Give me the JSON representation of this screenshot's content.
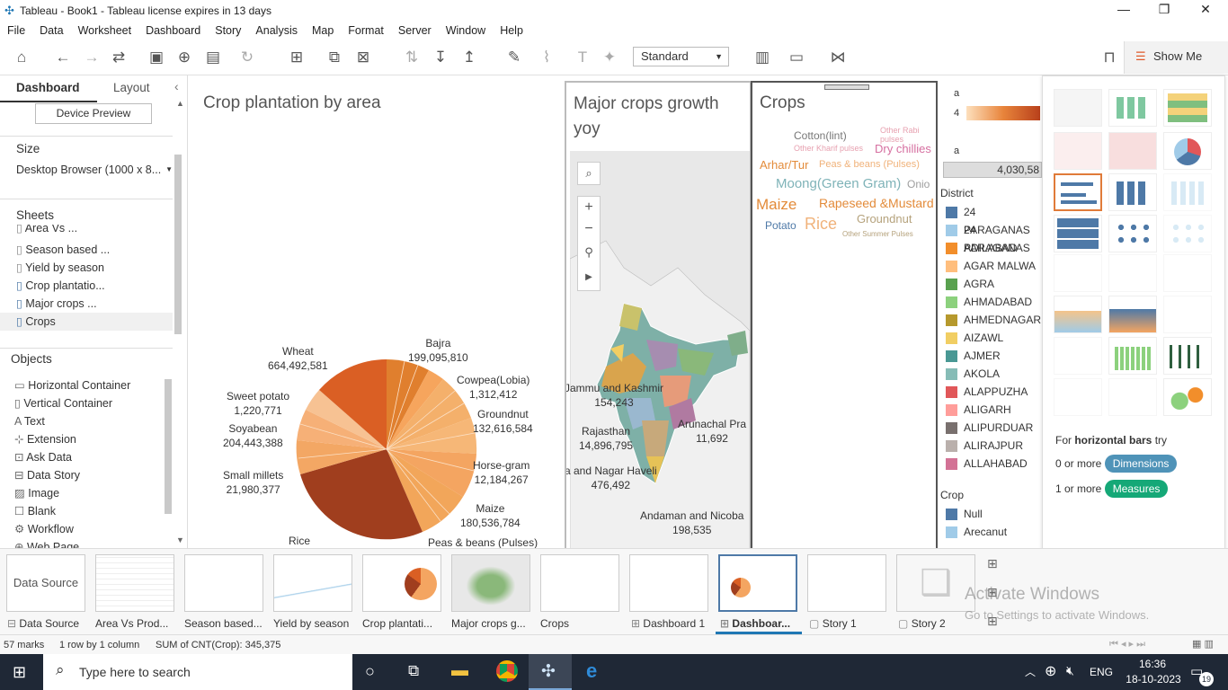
{
  "window": {
    "title": "Tableau - Book1 - Tableau license expires in 13 days"
  },
  "menu": [
    "File",
    "Data",
    "Worksheet",
    "Dashboard",
    "Story",
    "Analysis",
    "Map",
    "Format",
    "Server",
    "Window",
    "Help"
  ],
  "toolbar": {
    "fit_select": "Standard",
    "show_me": "Show Me"
  },
  "left": {
    "tab_dashboard": "Dashboard",
    "tab_layout": "Layout",
    "device_preview": "Device Preview",
    "size_header": "Size",
    "size_value": "Desktop Browser (1000 x 8...",
    "sheets_header": "Sheets",
    "sheets": [
      "Area Vs ...",
      "Season based ...",
      "Yield by season",
      "Crop plantatio...",
      "Major crops ...",
      "Crops"
    ],
    "objects_header": "Objects",
    "objects": [
      "Horizontal Container",
      "Vertical Container",
      "Text",
      "Extension",
      "Ask Data",
      "Data Story",
      "Image",
      "Blank",
      "Workflow",
      "Web Page"
    ]
  },
  "dashboard": {
    "pie_title": "Crop plantation by area",
    "pie_labels": [
      {
        "name": "Wheat",
        "value": "664,492,581"
      },
      {
        "name": "Bajra",
        "value": "199,095,810"
      },
      {
        "name": "Cowpea(Lobia)",
        "value": "1,312,412"
      },
      {
        "name": "Groundnut",
        "value": "132,616,584"
      },
      {
        "name": "Horse-gram",
        "value": "12,184,267"
      },
      {
        "name": "Maize",
        "value": "180,536,784"
      },
      {
        "name": "Peas & beans (Pulses)",
        "value": ""
      },
      {
        "name": "Rice",
        "value": ""
      },
      {
        "name": "Small millets",
        "value": "21,980,377"
      },
      {
        "name": "Soyabean",
        "value": "204,443,388"
      },
      {
        "name": "Sweet potato",
        "value": "1,220,771"
      }
    ],
    "map_title": "Major crops growth yoy",
    "map_labels": [
      {
        "name": "Jammu and Kashmir",
        "value": "154,243"
      },
      {
        "name": "Rajasthan",
        "value": "14,896,795"
      },
      {
        "name": "Arunachal Pra",
        "value": "11,692"
      },
      {
        "name": "a and Nagar Haveli",
        "value": "476,492"
      },
      {
        "name": "Andaman and Nicoba",
        "value": "198,535"
      }
    ],
    "crops_title": "Crops",
    "cloud": [
      {
        "t": "Other Rabi pulses",
        "c": "#e7a1b0",
        "s": 9
      },
      {
        "t": "Cotton(lint)",
        "c": "#777",
        "s": 12
      },
      {
        "t": "Other Kharif pulses",
        "c": "#e7a1b0",
        "s": 9
      },
      {
        "t": "Dry chillies",
        "c": "#d66fa0",
        "s": 13
      },
      {
        "t": "Arhar/Tur",
        "c": "#e38b3a",
        "s": 13
      },
      {
        "t": "Peas & beans (Pulses)",
        "c": "#f0b27a",
        "s": 11
      },
      {
        "t": "Moong(Green Gram)",
        "c": "#7fb3b8",
        "s": 15
      },
      {
        "t": "Onio",
        "c": "#9e9e9e",
        "s": 12
      },
      {
        "t": "Maize",
        "c": "#e38b3a",
        "s": 17
      },
      {
        "t": "Rapeseed &Mustard",
        "c": "#e38b3a",
        "s": 14
      },
      {
        "t": "Groundnut",
        "c": "#b5a27c",
        "s": 13
      },
      {
        "t": "Potato",
        "c": "#4e79a7",
        "s": 12
      },
      {
        "t": "Rice",
        "c": "#f0b27a",
        "s": 18
      },
      {
        "t": "Other Summer Pulses",
        "c": "#b5a27c",
        "s": 8
      }
    ],
    "legend": {
      "top_value": "4,030,58",
      "district_header": "District",
      "districts": [
        {
          "n": "24 PARAGANAS",
          "c": "#4e79a7"
        },
        {
          "n": "24 PARAGANAS",
          "c": "#a0cbe8"
        },
        {
          "n": "ADILABAD",
          "c": "#f28e2b"
        },
        {
          "n": "AGAR MALWA",
          "c": "#ffbe7d"
        },
        {
          "n": "AGRA",
          "c": "#59a14f"
        },
        {
          "n": "AHMADABAD",
          "c": "#8cd17d"
        },
        {
          "n": "AHMEDNAGAR",
          "c": "#b6992d"
        },
        {
          "n": "AIZAWL",
          "c": "#f1ce63"
        },
        {
          "n": "AJMER",
          "c": "#499894"
        },
        {
          "n": "AKOLA",
          "c": "#86bcb6"
        },
        {
          "n": "ALAPPUZHA",
          "c": "#e15759"
        },
        {
          "n": "ALIGARH",
          "c": "#ff9d9a"
        },
        {
          "n": "ALIPURDUAR",
          "c": "#79706e"
        },
        {
          "n": "ALIRAJPUR",
          "c": "#bab0ac"
        },
        {
          "n": "ALLAHABAD",
          "c": "#d37295"
        }
      ],
      "crop_header": "Crop",
      "crops": [
        {
          "n": "Null",
          "c": "#4e79a7"
        },
        {
          "n": "Arecanut",
          "c": "#a0cbe8"
        }
      ]
    }
  },
  "showme": {
    "hint_prefix": "For",
    "hint_bold": "horizontal bars",
    "hint_suffix": "try",
    "dim_prefix": "0 or more",
    "dim_pill": "Dimensions",
    "meas_prefix": "1 or more",
    "meas_pill": "Measures"
  },
  "tabs": [
    "Data Source",
    "Area Vs Prod...",
    "Season based...",
    "Yield by season",
    "Crop plantati...",
    "Major crops g...",
    "Crops",
    "Dashboard 1",
    "Dashboar...",
    "Story 1",
    "Story 2"
  ],
  "status": {
    "marks": "57 marks",
    "rows": "1 row by 1 column",
    "sum": "SUM of CNT(Crop): 345,375"
  },
  "watermark": {
    "line1": "Activate Windows",
    "line2": "Go to Settings to activate Windows."
  },
  "taskbar": {
    "search": "Type here to search",
    "lang": "ENG",
    "time": "16:36",
    "date": "18-10-2023",
    "notif": "19"
  }
}
